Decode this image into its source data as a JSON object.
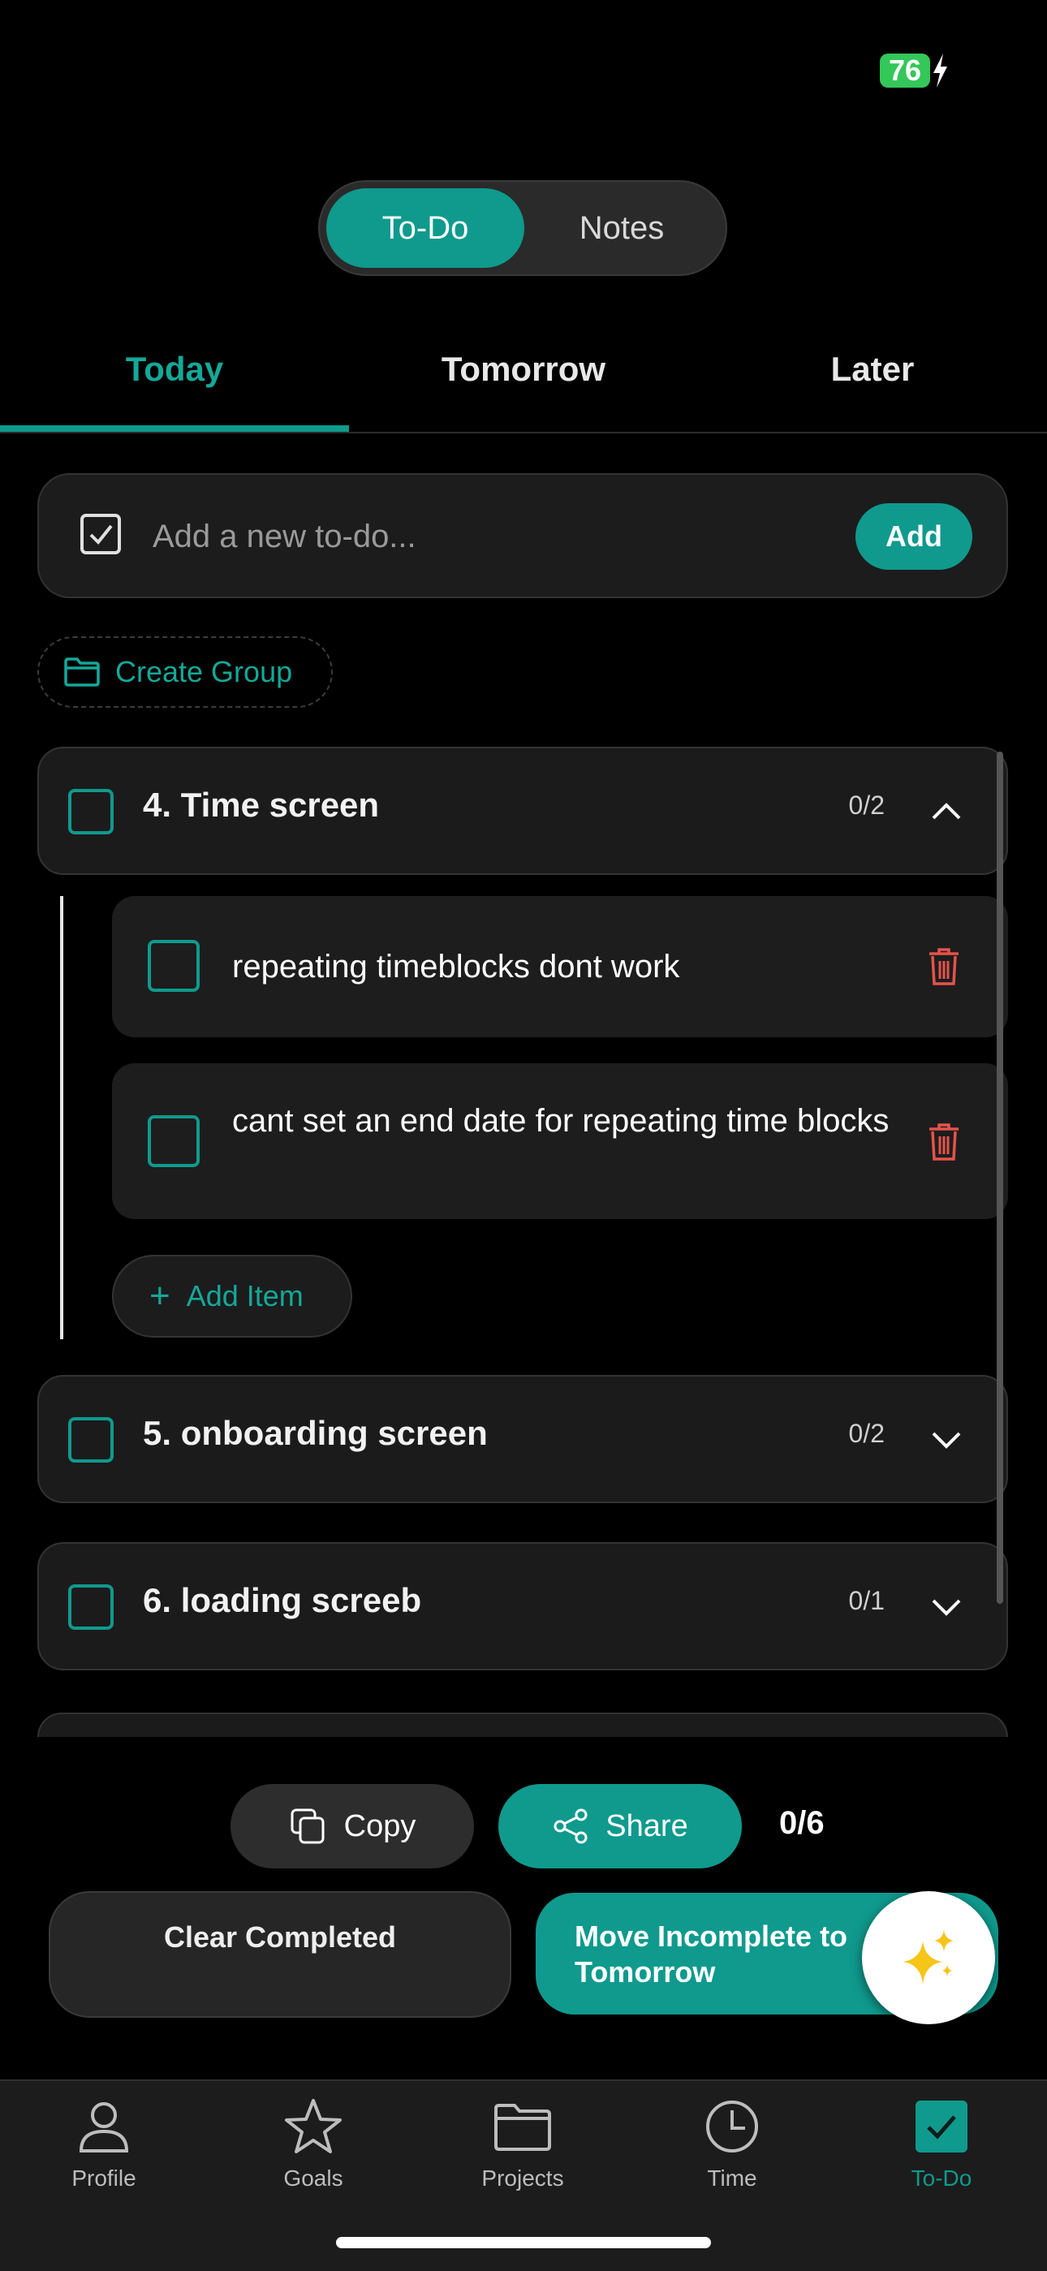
{
  "status": {
    "battery": "76"
  },
  "segment": {
    "active": "To-Do",
    "inactive": "Notes"
  },
  "tabs": [
    {
      "label": "Today"
    },
    {
      "label": "Tomorrow"
    },
    {
      "label": "Later"
    }
  ],
  "add_todo": {
    "placeholder": "Add a new to-do...",
    "button": "Add"
  },
  "create_group": "Create Group",
  "groups": [
    {
      "title": "4. Time screen",
      "count": "0/2",
      "expanded": true,
      "items": [
        {
          "text": "repeating timeblocks dont work"
        },
        {
          "text": "cant set an end date for repeating time blocks"
        }
      ],
      "add_item": "Add Item"
    },
    {
      "title": "5. onboarding screen",
      "count": "0/2",
      "expanded": false
    },
    {
      "title": "6. loading screeb",
      "count": "0/1",
      "expanded": false
    }
  ],
  "actions": {
    "copy": "Copy",
    "share": "Share",
    "progress": "0/6",
    "clear_completed": "Clear Completed",
    "move_incomplete": "Move Incomplete to Tomorrow"
  },
  "nav": [
    {
      "label": "Profile",
      "icon": "person-icon"
    },
    {
      "label": "Goals",
      "icon": "star-icon"
    },
    {
      "label": "Projects",
      "icon": "folder-icon"
    },
    {
      "label": "Time",
      "icon": "clock-icon"
    },
    {
      "label": "To-Do",
      "icon": "checkbox-icon",
      "active": true
    }
  ],
  "colors": {
    "accent": "#0f9a8d",
    "danger": "#e5534b",
    "background": "#000000"
  }
}
